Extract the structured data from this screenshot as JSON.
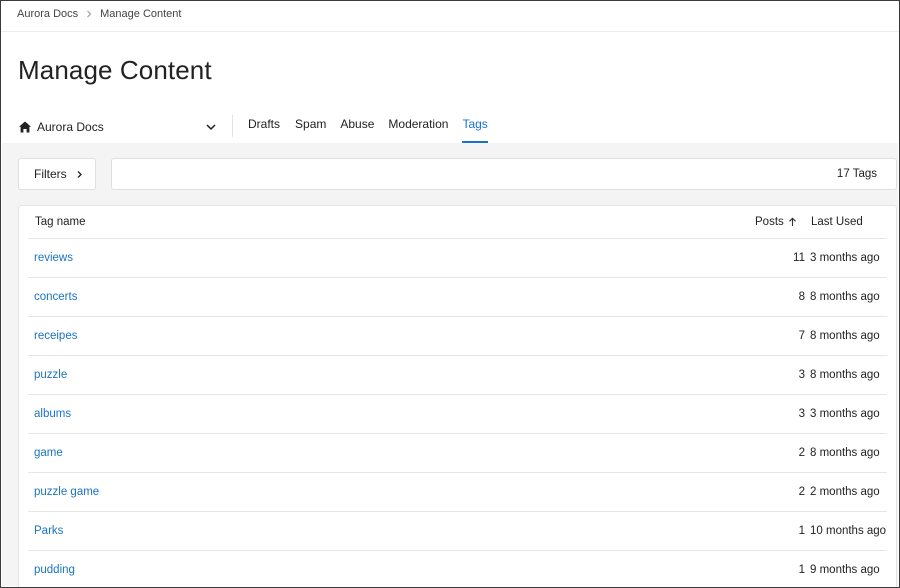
{
  "breadcrumb": {
    "items": [
      "Aurora Docs",
      "Manage Content"
    ]
  },
  "page": {
    "title": "Manage Content"
  },
  "community": {
    "selected": "Aurora Docs"
  },
  "tabs": [
    {
      "label": "Drafts",
      "active": false
    },
    {
      "label": "Spam",
      "active": false
    },
    {
      "label": "Abuse",
      "active": false
    },
    {
      "label": "Moderation",
      "active": false
    },
    {
      "label": "Tags",
      "active": true
    }
  ],
  "filters": {
    "label": "Filters"
  },
  "summary": {
    "count_label": "17 Tags"
  },
  "table": {
    "columns": {
      "name": "Tag name",
      "posts": "Posts",
      "last_used": "Last Used"
    },
    "sort": {
      "column": "Posts",
      "direction": "ascending"
    },
    "rows": [
      {
        "name": "reviews",
        "posts": "11",
        "last_used": "3 months ago"
      },
      {
        "name": "concerts",
        "posts": "8",
        "last_used": "8 months ago"
      },
      {
        "name": "receipes",
        "posts": "7",
        "last_used": "8 months ago"
      },
      {
        "name": "puzzle",
        "posts": "3",
        "last_used": "8 months ago"
      },
      {
        "name": "albums",
        "posts": "3",
        "last_used": "3 months ago"
      },
      {
        "name": "game",
        "posts": "2",
        "last_used": "8 months ago"
      },
      {
        "name": "puzzle game",
        "posts": "2",
        "last_used": "2 months ago"
      },
      {
        "name": "Parks",
        "posts": "1",
        "last_used": "10 months ago"
      },
      {
        "name": "pudding",
        "posts": "1",
        "last_used": "9 months ago"
      }
    ]
  },
  "colors": {
    "accent": "#1a73c9",
    "background_section": "#f4f4f4"
  },
  "icons": {
    "home": "home-icon",
    "dropdown": "chevron-down-icon",
    "filters": "chevron-right-icon",
    "sort": "arrow-up-icon",
    "breadcrumb_sep": "chevron-right-icon"
  }
}
